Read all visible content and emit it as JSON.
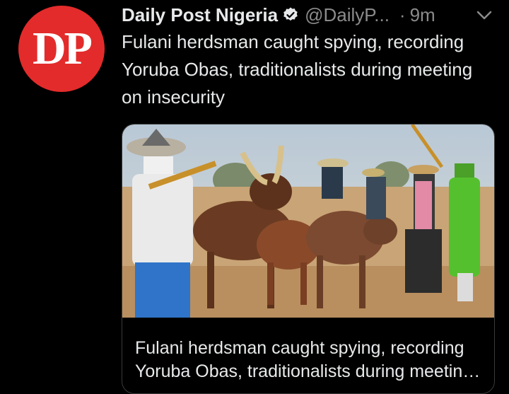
{
  "tweet": {
    "avatar_text": "DP",
    "display_name": "Daily Post Nigeria",
    "verified_icon": "verified-badge-icon",
    "handle": "@DailyP...",
    "separator": "·",
    "time": "9m",
    "menu_icon": "chevron-down-icon",
    "text": "Fulani herdsman caught spying, recording Yoruba Obas, traditionalists during meeting on insecurity"
  },
  "card": {
    "image_description": "photo-herdsmen-with-cattle",
    "title": "Fulani herdsman caught spying, recording Yoruba Obas, traditionalists during meeting on insecurity"
  },
  "colors": {
    "background": "#000000",
    "avatar_red": "#e32b2b",
    "text_primary": "#e7e9ea",
    "text_secondary": "#8b8b8b"
  }
}
